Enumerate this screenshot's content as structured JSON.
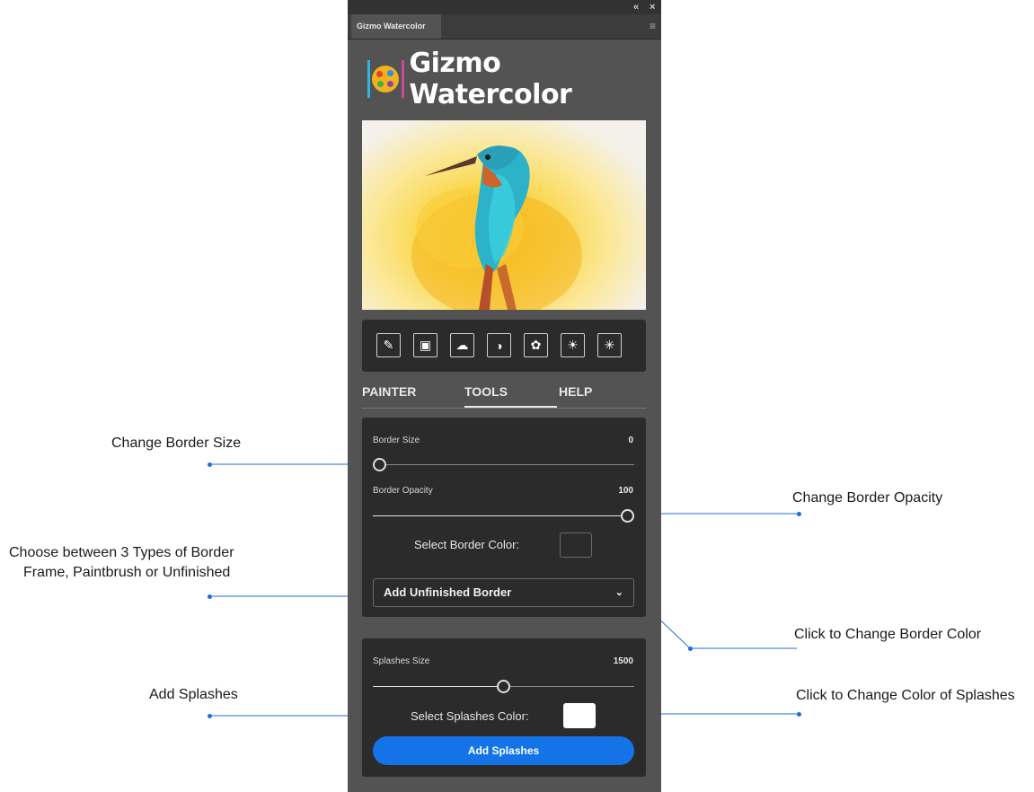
{
  "panel": {
    "window_tab": "Gizmo Watercolor",
    "collapse_glyph": "«",
    "close_glyph": "×",
    "menu_glyph": "≡",
    "brand_name": "Gizmo Watercolor",
    "toolbar_icons": [
      "brush-icon",
      "frame-icon",
      "palette-icon",
      "contrast-icon",
      "color-palette-icon",
      "brightness-low-icon",
      "brightness-high-icon"
    ],
    "toolbar_glyphs": [
      "✎",
      "▣",
      "☁",
      "◑",
      "✿",
      "☀",
      "✳"
    ],
    "nav_tabs": [
      {
        "label": "PAINTER",
        "active": false
      },
      {
        "label": "TOOLS",
        "active": true
      },
      {
        "label": "HELP",
        "active": false
      }
    ],
    "border_card": {
      "border_size_label": "Border Size",
      "border_size_value": "0",
      "border_size_level": 0.0,
      "border_opacity_label": "Border Opacity",
      "border_opacity_value": "100",
      "border_opacity_level": 1.0,
      "select_color_label": "Select Border Color:",
      "border_color": "#2b2b2b",
      "border_type_selected": "Add Unfinished Border",
      "chevron_glyph": "⌄"
    },
    "splashes_card": {
      "splashes_size_label": "Splashes Size",
      "splashes_size_value": "1500",
      "splashes_size_level": 0.5,
      "select_color_label": "Select Splashes Color:",
      "splashes_color": "#ffffff",
      "add_button_label": "Add Splashes"
    },
    "accent_color": "#1473e6"
  },
  "annotations": {
    "change_border_size": "Change Border Size",
    "choose_border_line1": "Choose between 3 Types of Border",
    "choose_border_line2": "Frame, Paintbrush or Unfinished",
    "add_splashes": "Add Splashes",
    "change_border_opacity": "Change Border Opacity",
    "change_border_color": "Click to Change Border Color",
    "change_splashes_color": "Click to Change Color of Splashes",
    "line_color": "#1e6fd9"
  }
}
